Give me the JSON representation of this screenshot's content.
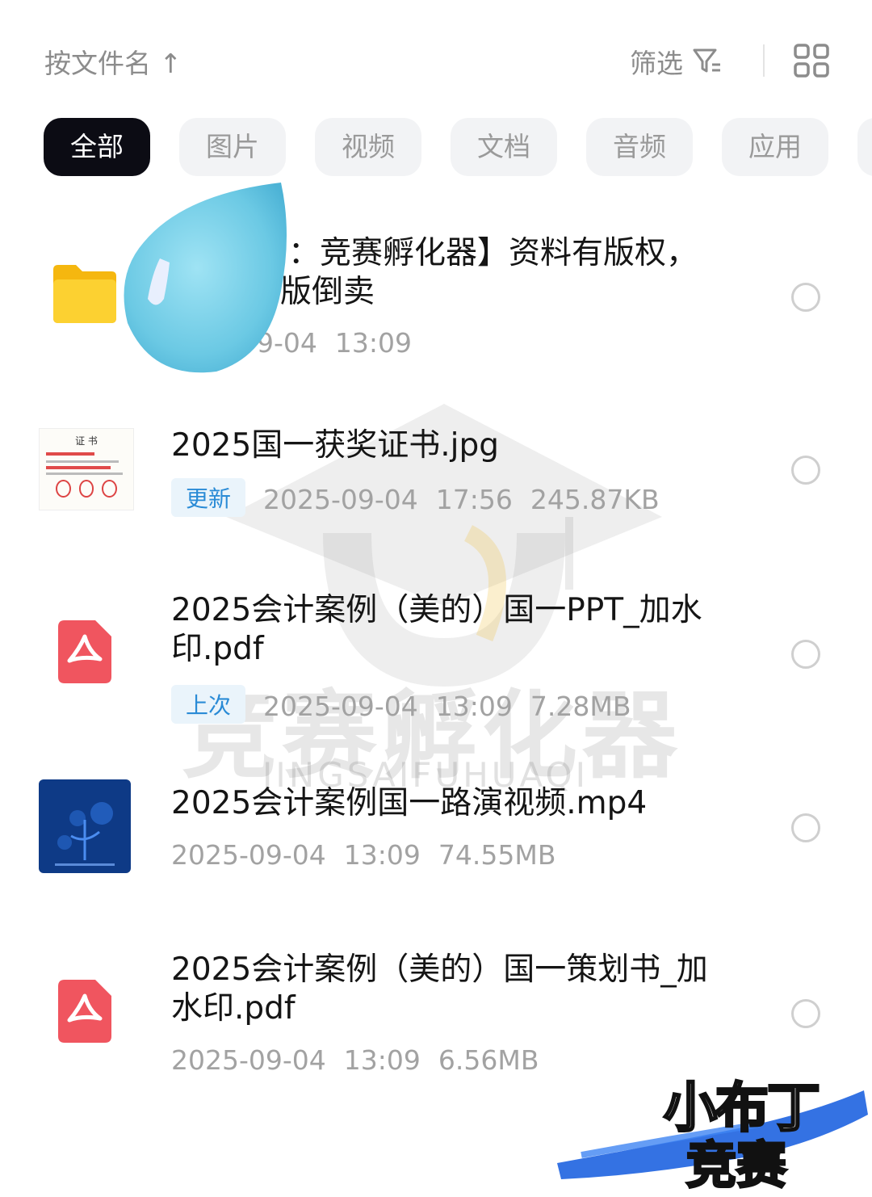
{
  "toolbar": {
    "sort_label": "按文件名 ↑",
    "filter_label": "筛选"
  },
  "tabs": [
    {
      "label": "全部",
      "active": true
    },
    {
      "label": "图片",
      "active": false
    },
    {
      "label": "视频",
      "active": false
    },
    {
      "label": "文档",
      "active": false
    },
    {
      "label": "音频",
      "active": false
    },
    {
      "label": "应用",
      "active": false
    }
  ],
  "files": [
    {
      "name": "：竞赛孵化器】资料有版权，",
      "name_line2": "版倒卖",
      "date": "9-04",
      "time": "13:09",
      "icon": "folder-icon"
    },
    {
      "name": "2025国一获奖证书.jpg",
      "badge": "更新",
      "date": "2025-09-04",
      "time": "17:56",
      "size": "245.87KB",
      "icon": "certificate-thumbnail",
      "thumb_text": "证 书"
    },
    {
      "name": "2025会计案例（美的）国一PPT_加水",
      "name_line2": "印.pdf",
      "badge": "上次",
      "date": "2025-09-04",
      "time": "13:09",
      "size": "7.28MB",
      "icon": "pdf-icon"
    },
    {
      "name": "2025会计案例国一路演视频.mp4",
      "date": "2025-09-04",
      "time": "13:09",
      "size": "74.55MB",
      "icon": "video-thumbnail"
    },
    {
      "name": "2025会计案例（美的）国一策划书_加",
      "name_line2": "水印.pdf",
      "date": "2025-09-04",
      "time": "13:09",
      "size": "6.56MB",
      "icon": "pdf-icon"
    }
  ],
  "watermark": {
    "text": "竞赛孵化器",
    "sub": "JINGSAIFUHUAQI"
  },
  "brand": {
    "line1": "小布丁",
    "line2": "竞赛"
  },
  "colors": {
    "active_tab_bg": "#0c0c14",
    "badge_text": "#2a8bd6",
    "pdf_red": "#f0555f",
    "folder_yellow": "#f8c21a"
  }
}
